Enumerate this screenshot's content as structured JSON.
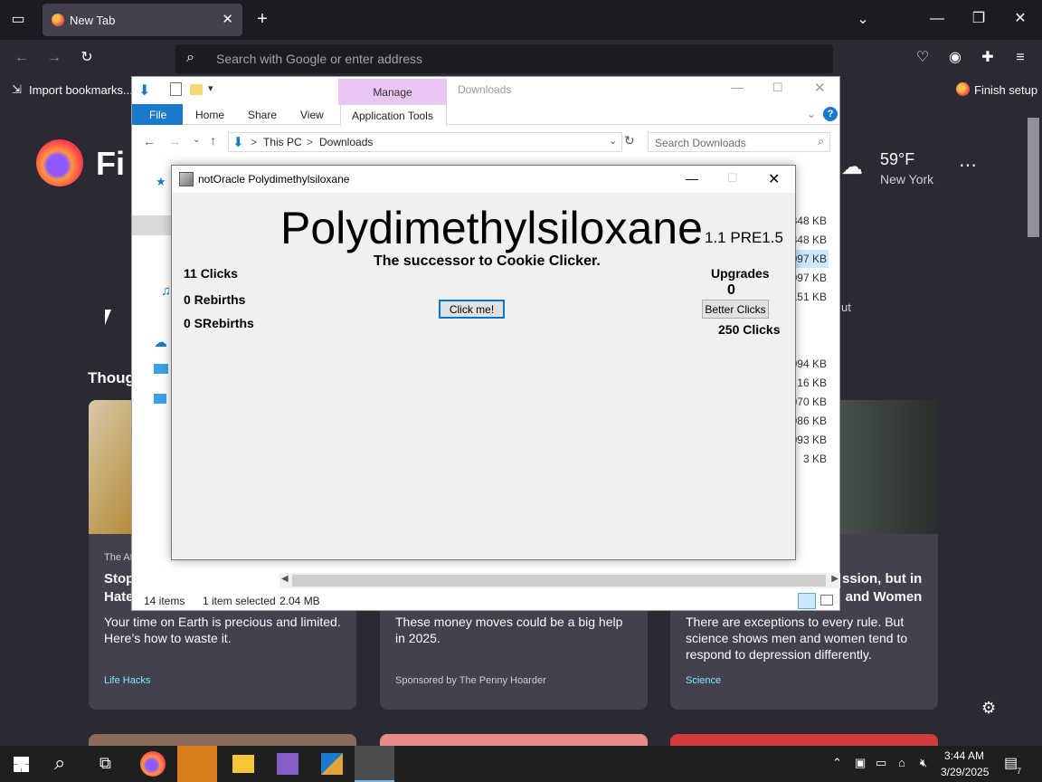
{
  "browser": {
    "tab_title": "New Tab",
    "tab_close": "✕",
    "new_tab": "+",
    "url_placeholder": "Search with Google or enter address",
    "bookmarks": {
      "import": "Import bookmarks...",
      "finish_setup": "Finish setup"
    }
  },
  "newtab": {
    "brand": "Fi",
    "weather": {
      "temp": "59°F",
      "city": "New York"
    },
    "section_title": "Thoug",
    "partial_right_text": "ut",
    "cards": [
      {
        "source": "The At",
        "headline": "Stop\nHate",
        "excerpt": "Your time on Earth is precious and limited. Here’s how to waste it.",
        "context": "Life Hacks"
      },
      {
        "source": "",
        "headline": "",
        "excerpt": "These money moves could be a big help in 2025.",
        "context": "Sponsored by The Penny Hoarder"
      },
      {
        "source": "",
        "headline": "ssion, but in\nand Women",
        "excerpt": "There are exceptions to every rule. But science shows men and women tend to respond to depression differently.",
        "context": "Science"
      }
    ]
  },
  "explorer": {
    "manage_tab": "Manage",
    "window_title": "Downloads",
    "ribbon": {
      "file": "File",
      "home": "Home",
      "share": "Share",
      "view": "View",
      "app_tools": "Application Tools"
    },
    "breadcrumb": {
      "root": "This PC",
      "sep": ">",
      "folder": "Downloads"
    },
    "search_placeholder": "Search Downloads",
    "sizes": [
      "348 KB",
      "348 KB",
      "097 KB",
      "097 KB",
      "151 KB",
      "094 KB",
      "16 KB",
      "070 KB",
      "986 KB",
      "093 KB",
      "3 KB"
    ],
    "status": {
      "count": "14 items",
      "selected": "1 item selected",
      "size": "2.04 MB"
    }
  },
  "game": {
    "window_title": "notOracle Polydimethylsiloxane",
    "title": "Polydimethylsiloxane",
    "version": "1.1 PRE1.5",
    "subtitle": "The successor to Cookie Clicker.",
    "clicks": "11 Clicks",
    "rebirths": "0 Rebirths",
    "srebirths": "0 SRebirths",
    "click_button": "Click me!",
    "upgrades_label": "Upgrades",
    "upgrades_count": "0",
    "upgrade_button": "Better Clicks",
    "upgrade_cost": "250 Clicks"
  },
  "taskbar": {
    "time": "3:44 AM",
    "date": "3/29/2025",
    "notifications": "7"
  }
}
